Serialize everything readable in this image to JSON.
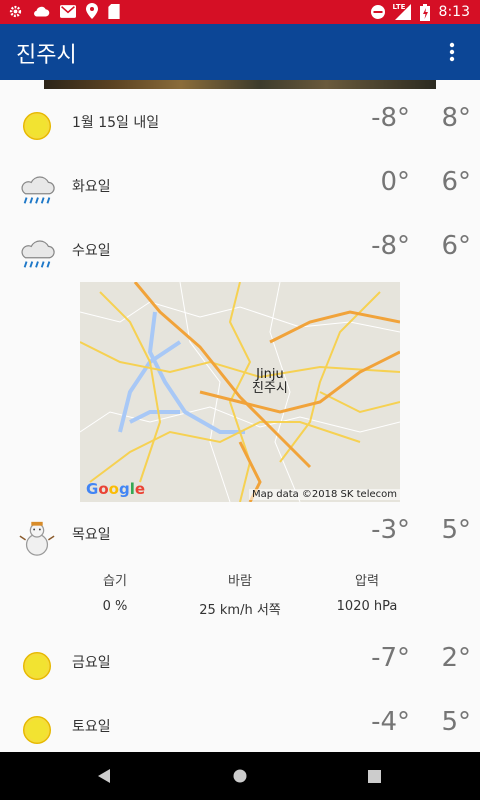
{
  "status_bar": {
    "time": "8:13",
    "network": "LTE"
  },
  "app_bar": {
    "title": "진주시"
  },
  "forecast": [
    {
      "day": "1월 15일 내일",
      "low": "-8°",
      "high": "8°",
      "icon": "sun-icon"
    },
    {
      "day": "화요일",
      "low": "0°",
      "high": "6°",
      "icon": "rain-cloud-icon"
    },
    {
      "day": "수요일",
      "low": "-8°",
      "high": "6°",
      "icon": "rain-cloud-icon"
    },
    {
      "day": "목요일",
      "low": "-3°",
      "high": "5°",
      "icon": "snowman-icon"
    },
    {
      "day": "금요일",
      "low": "-7°",
      "high": "2°",
      "icon": "sun-icon"
    },
    {
      "day": "토요일",
      "low": "-4°",
      "high": "5°",
      "icon": "sun-icon"
    }
  ],
  "map": {
    "city_en": "Jinju",
    "city_ko": "진주시",
    "google": "Google",
    "attribution": "Map data ©2018 SK telecom"
  },
  "details": {
    "humidity_label": "습기",
    "humidity_value": "0 %",
    "wind_label": "바람",
    "wind_value": "25 km/h 서쪽",
    "pressure_label": "압력",
    "pressure_value": "1020 hPa"
  },
  "colors": {
    "status_bar": "#d50f25",
    "app_bar": "#0c4696",
    "sun": "#f2d31b"
  }
}
